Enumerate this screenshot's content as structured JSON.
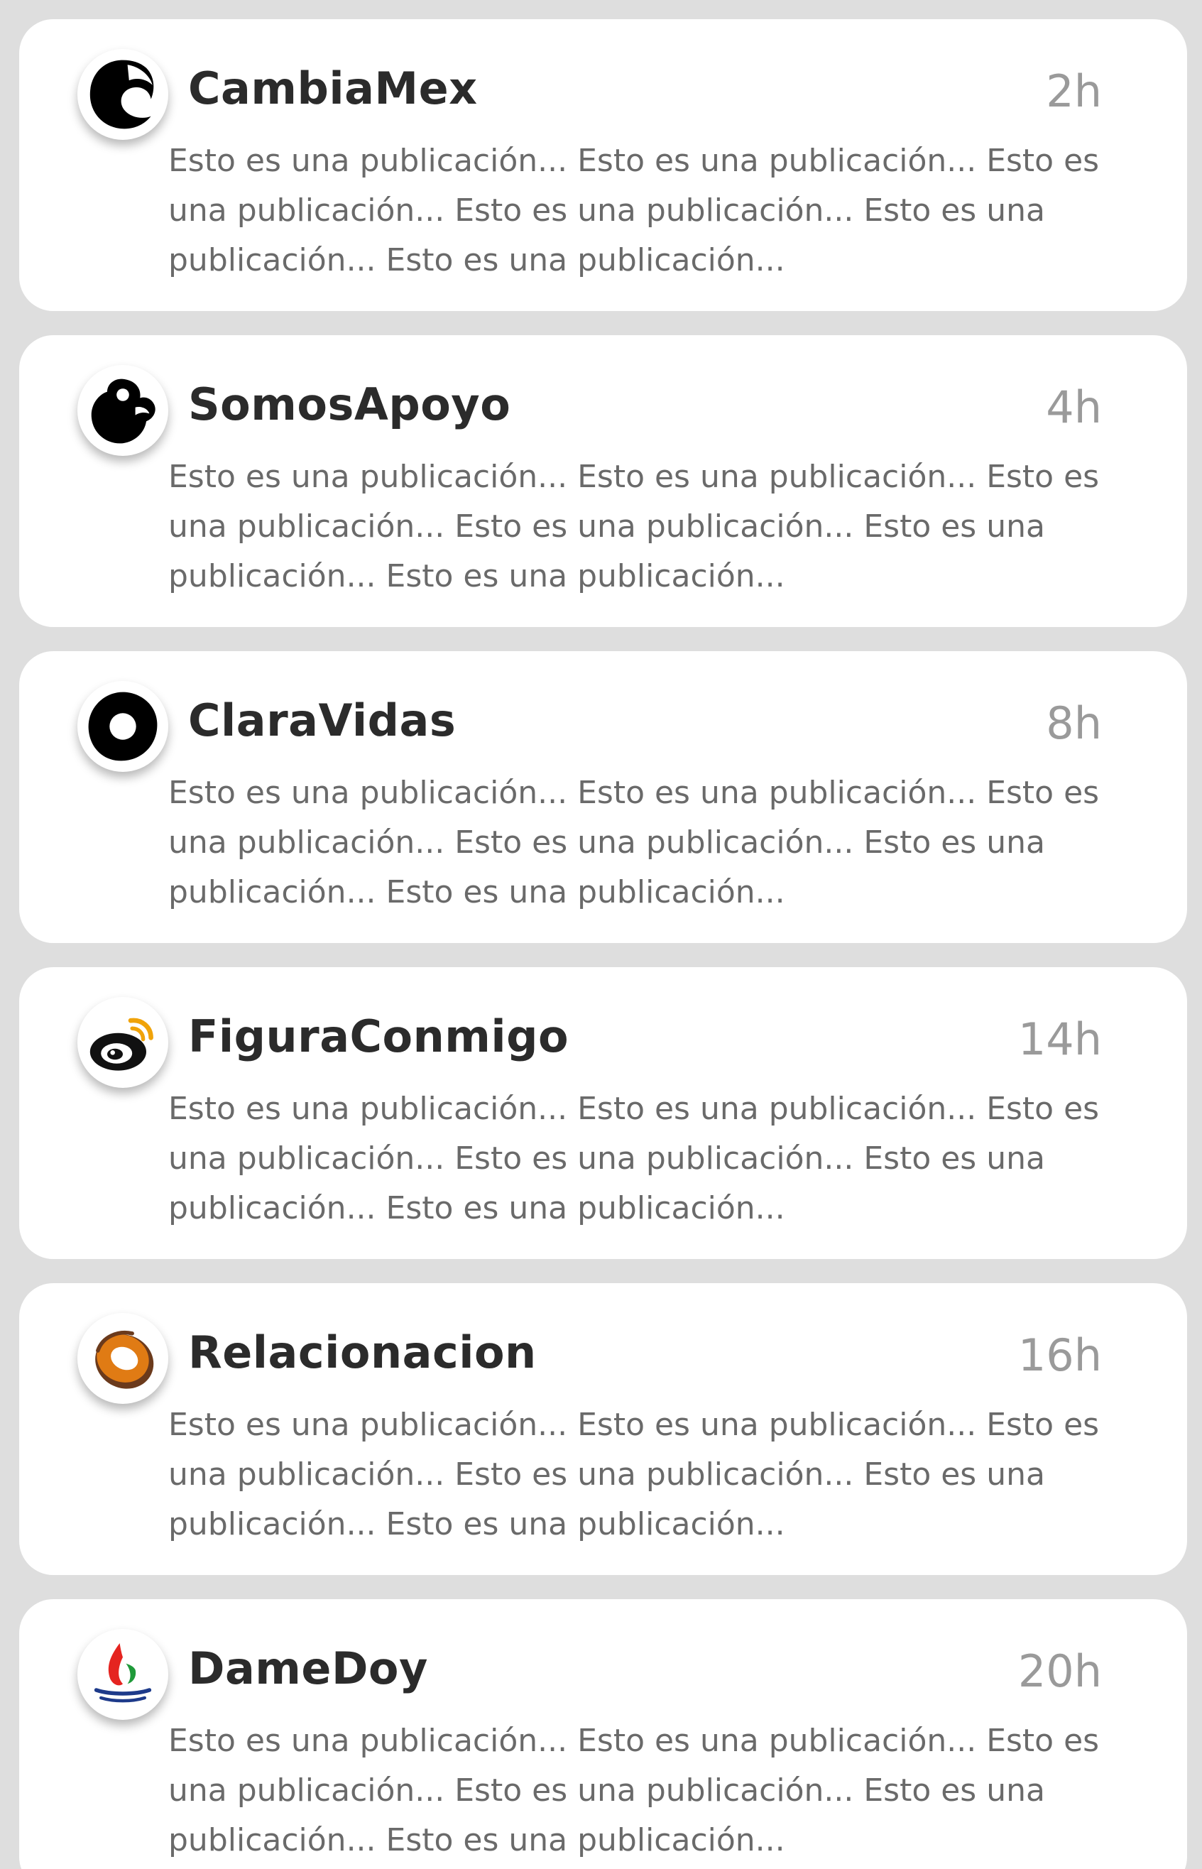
{
  "feed": {
    "posts": [
      {
        "name": "CambiaMex",
        "time": "2h",
        "text": "Esto es una publicación... Esto es una publicación... Esto es una publicación... Esto es una publicación... Esto es una publicación... Esto es una publicación...",
        "avatar_icon": "cambiamex-logo-icon"
      },
      {
        "name": "SomosApoyo",
        "time": "4h",
        "text": "Esto es una publicación... Esto es una publicación... Esto es una publicación... Esto es una publicación... Esto es una publicación... Esto es una publicación...",
        "avatar_icon": "somosapoyo-logo-icon"
      },
      {
        "name": "ClaraVidas",
        "time": "8h",
        "text": "Esto es una publicación... Esto es una publicación... Esto es una publicación... Esto es una publicación... Esto es una publicación... Esto es una publicación...",
        "avatar_icon": "claravidas-logo-icon"
      },
      {
        "name": "FiguraConmigo",
        "time": "14h",
        "text": "Esto es una publicación... Esto es una publicación... Esto es una publicación... Esto es una publicación... Esto es una publicación... Esto es una publicación...",
        "avatar_icon": "figuraconmigo-logo-icon"
      },
      {
        "name": "Relacionacion",
        "time": "16h",
        "text": "Esto es una publicación... Esto es una publicación... Esto es una publicación... Esto es una publicación... Esto es una publicación... Esto es una publicación...",
        "avatar_icon": "relacionacion-logo-icon"
      },
      {
        "name": "DameDoy",
        "time": "20h",
        "text": "Esto es una publicación... Esto es una publicación... Esto es una publicación... Esto es una publicación... Esto es una publicación... Esto es una publicación...",
        "avatar_icon": "damedoy-logo-icon"
      }
    ]
  },
  "colors": {
    "background": "#dedede",
    "card": "#ffffff",
    "name_text": "#2b2b2b",
    "time_text": "#9a9a9a",
    "body_text": "#6a6a6a",
    "relacionacion_orange": "#e07b14",
    "relacionacion_brown": "#6b3a1c",
    "damedoy_red": "#e52420",
    "damedoy_green": "#1f9a3a",
    "damedoy_blue": "#1d3a8a"
  }
}
